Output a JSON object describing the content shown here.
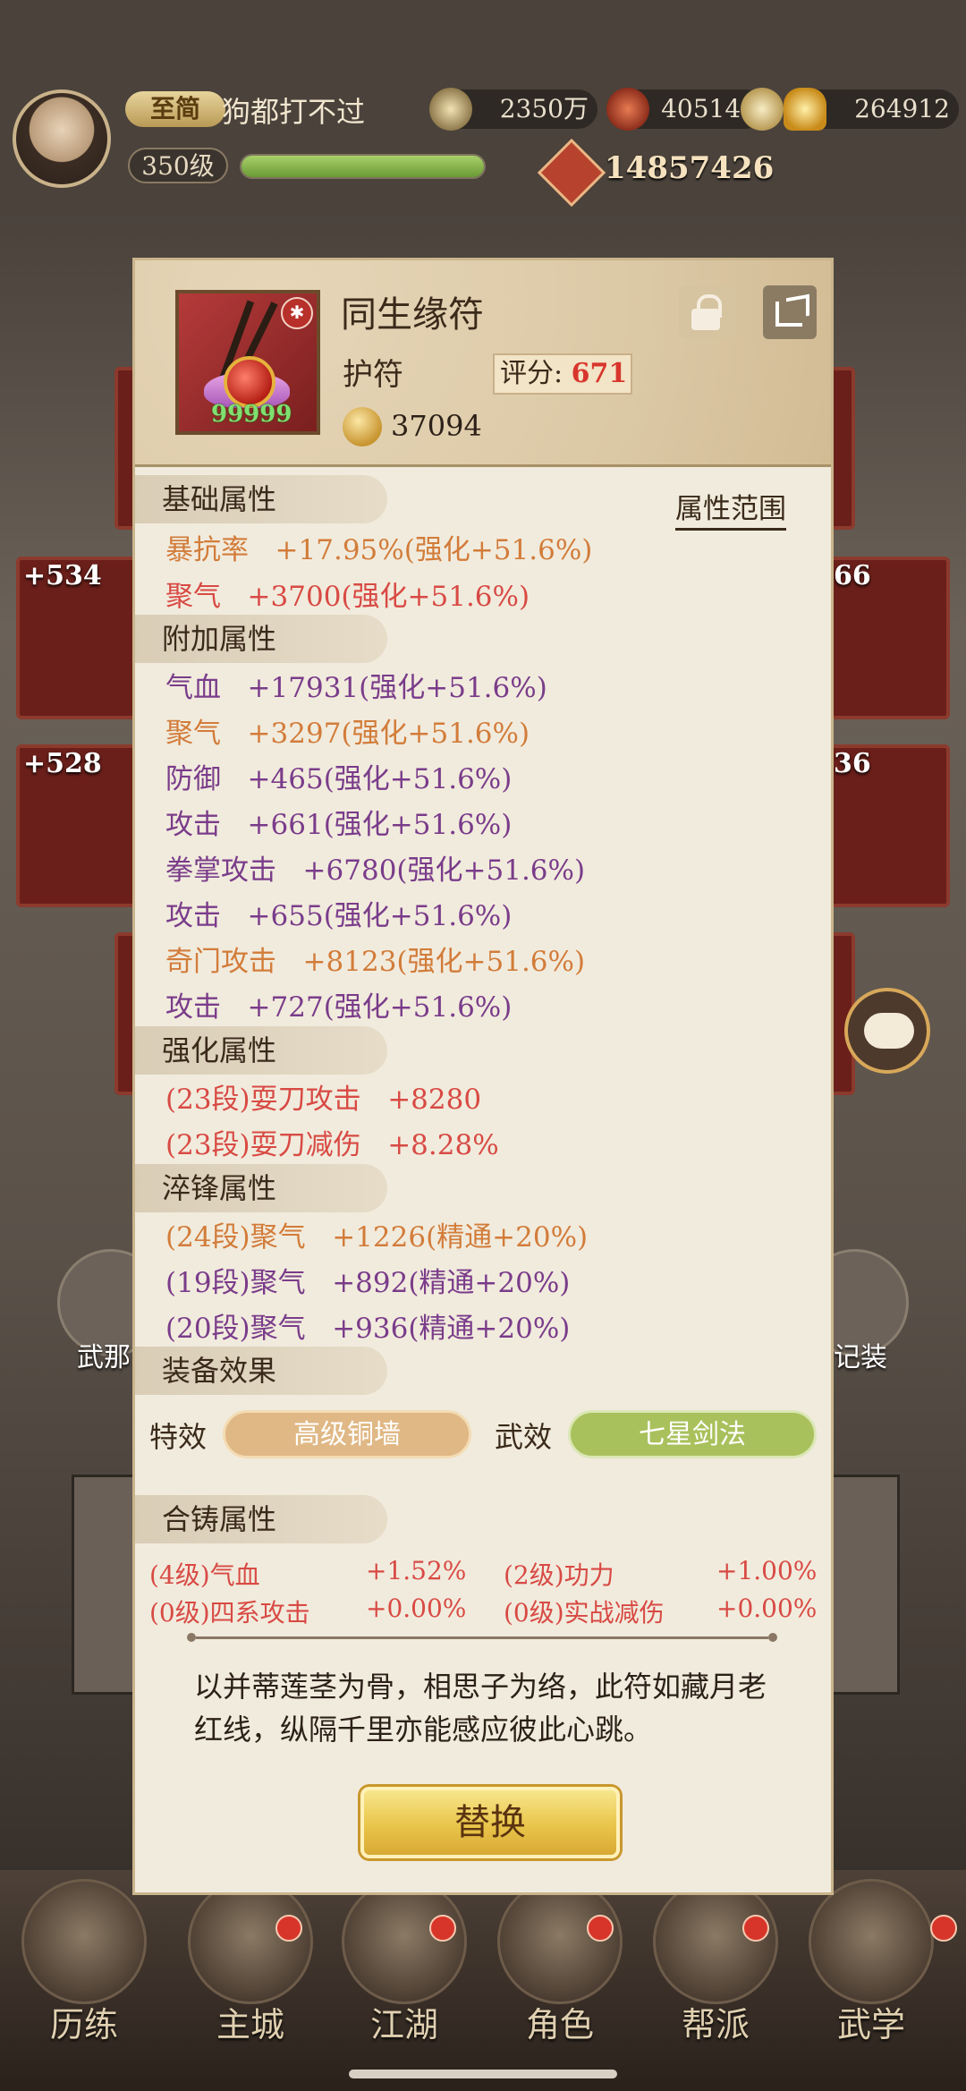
{
  "player": {
    "vip": "至简",
    "name": "狗都打不过",
    "level": "350级",
    "exp_fraction": 1.0,
    "silver": "2350万",
    "res2": "405141",
    "gold": "264912",
    "power": "14857426"
  },
  "side": {
    "left": [
      "+534",
      "+528"
    ],
    "right": [
      "66",
      "36"
    ]
  },
  "item": {
    "name": "同生缘符",
    "type": "护符",
    "score_label": "评分:",
    "score": "671",
    "coin": "37094",
    "stars": "99999",
    "badge": "✱"
  },
  "range_button": "属性范围",
  "sections": {
    "base": "基础属性",
    "extra": "附加属性",
    "enhance": "强化属性",
    "temper": "淬锋属性",
    "effect": "装备效果",
    "forge": "合铸属性"
  },
  "base_attrs": [
    "暴抗率   +17.95%(强化+51.6%)",
    "聚气   +3700(强化+51.6%)"
  ],
  "extra_attrs": [
    "气血   +17931(强化+51.6%)",
    "聚气   +3297(强化+51.6%)",
    "防御   +465(强化+51.6%)",
    "攻击   +661(强化+51.6%)",
    "拳掌攻击   +6780(强化+51.6%)",
    "攻击   +655(强化+51.6%)",
    "奇门攻击   +8123(强化+51.6%)",
    "攻击   +727(强化+51.6%)"
  ],
  "enhance_attrs": [
    "(23段)耍刀攻击   +8280",
    "(23段)耍刀减伤   +8.28%"
  ],
  "temper_attrs": [
    "(24段)聚气   +1226(精通+20%)",
    "(19段)聚气   +892(精通+20%)",
    "(20段)聚气   +936(精通+20%)"
  ],
  "effects": {
    "special_label": "特效",
    "special_value": "高级铜墙",
    "martial_label": "武效",
    "martial_value": "七星剑法"
  },
  "forge_attrs": [
    {
      "name": "(4级)气血",
      "value": "+1.52%"
    },
    {
      "name": "(2级)功力",
      "value": "+1.00%"
    },
    {
      "name": "(0级)四系攻击",
      "value": "+0.00%"
    },
    {
      "name": "(0级)实战减伤",
      "value": "+0.00%"
    }
  ],
  "description": "以并蒂莲茎为骨，相思子为络，此符如藏月老红线，纵隔千里亦能感应彼此心跳。",
  "replace_button": "替换",
  "nav": [
    "历练",
    "主城",
    "江湖",
    "角色",
    "帮派",
    "武学"
  ],
  "side_buttons": {
    "left_partial": "武那",
    "right_partial": "记装"
  },
  "colors": {
    "orange_attr": "#d27c3a",
    "red_attr": "#d84a44",
    "purple_attr": "#7a3c8a",
    "score": "#d8362d",
    "special_pill": "#e0b885",
    "martial_pill": "#a9c15c"
  }
}
